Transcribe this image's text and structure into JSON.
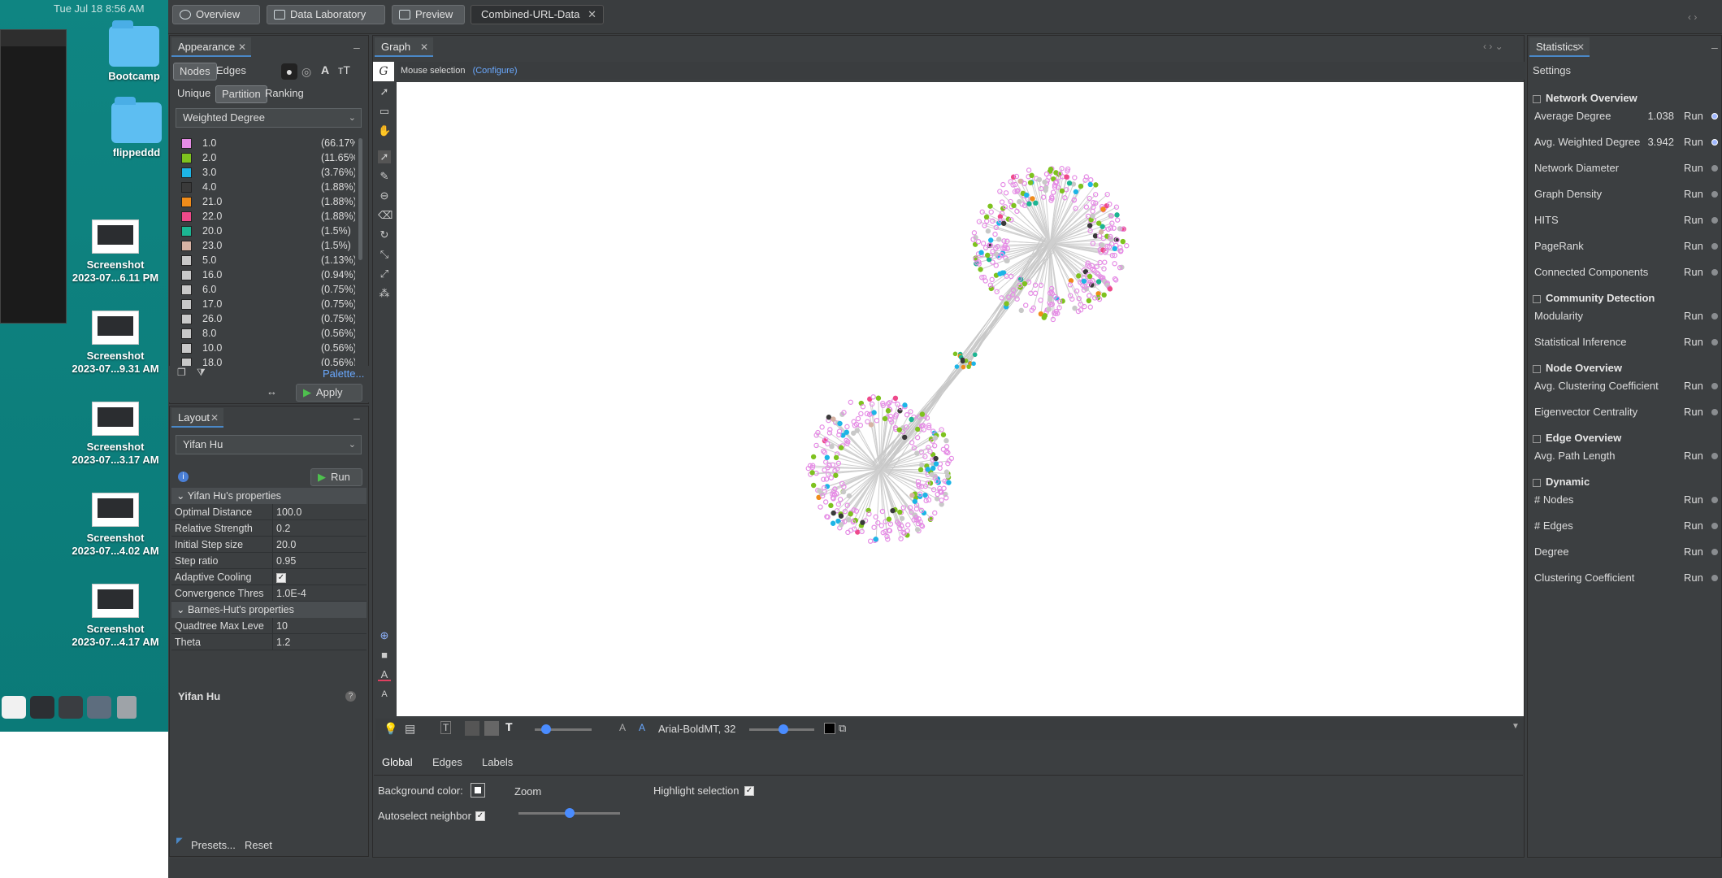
{
  "menubar": {
    "datetime": "Tue Jul 18  8:56 AM"
  },
  "desktop": {
    "folders": [
      {
        "label": "Bootcamp"
      },
      {
        "label": "flippeddd"
      }
    ],
    "screenshots": [
      {
        "line1": "Screenshot",
        "line2": "2023-07...6.11 PM"
      },
      {
        "line1": "Screenshot",
        "line2": "2023-07...9.31 AM"
      },
      {
        "line1": "Screenshot",
        "line2": "2023-07...3.17 AM"
      },
      {
        "line1": "Screenshot",
        "line2": "2023-07...4.02 AM"
      },
      {
        "line1": "Screenshot",
        "line2": "2023-07...4.17 AM"
      }
    ]
  },
  "top_tabs": [
    {
      "label": "Overview",
      "icon": "globe-icon"
    },
    {
      "label": "Data Laboratory",
      "icon": "table-icon"
    },
    {
      "label": "Preview",
      "icon": "monitor-icon"
    }
  ],
  "workspace_tab": {
    "label": "Combined-URL-Data"
  },
  "appearance": {
    "tab": "Appearance",
    "subtabs": [
      "Nodes",
      "Edges"
    ],
    "modes": [
      "Unique",
      "Partition",
      "Ranking"
    ],
    "attribute": "Weighted Degree",
    "partitions": [
      {
        "value": "1.0",
        "pct": "(66.17%)",
        "color": "#e58ce5"
      },
      {
        "value": "2.0",
        "pct": "(11.65%)",
        "color": "#7ec21f"
      },
      {
        "value": "3.0",
        "pct": "(3.76%)",
        "color": "#1db5e6"
      },
      {
        "value": "4.0",
        "pct": "(1.88%)",
        "color": "#3a3a3a"
      },
      {
        "value": "21.0",
        "pct": "(1.88%)",
        "color": "#f08c1a"
      },
      {
        "value": "22.0",
        "pct": "(1.88%)",
        "color": "#ee4a8a"
      },
      {
        "value": "20.0",
        "pct": "(1.5%)",
        "color": "#1cb592"
      },
      {
        "value": "23.0",
        "pct": "(1.5%)",
        "color": "#d6b3a4"
      },
      {
        "value": "5.0",
        "pct": "(1.13%)",
        "color": "#c8c8c8"
      },
      {
        "value": "16.0",
        "pct": "(0.94%)",
        "color": "#c8c8c8"
      },
      {
        "value": "6.0",
        "pct": "(0.75%)",
        "color": "#c8c8c8"
      },
      {
        "value": "17.0",
        "pct": "(0.75%)",
        "color": "#c8c8c8"
      },
      {
        "value": "26.0",
        "pct": "(0.75%)",
        "color": "#c8c8c8"
      },
      {
        "value": "8.0",
        "pct": "(0.56%)",
        "color": "#c8c8c8"
      },
      {
        "value": "10.0",
        "pct": "(0.56%)",
        "color": "#c8c8c8"
      },
      {
        "value": "18.0",
        "pct": "(0.56%)",
        "color": "#c8c8c8"
      }
    ],
    "palette_link": "Palette...",
    "arrows": "↔",
    "apply": "Apply"
  },
  "layout": {
    "tab": "Layout",
    "algorithm": "Yifan Hu",
    "run": "Run",
    "section1": "Yifan Hu's properties",
    "props1": [
      {
        "k": "Optimal Distance",
        "v": "100.0"
      },
      {
        "k": "Relative Strength",
        "v": "0.2"
      },
      {
        "k": "Initial Step size",
        "v": "20.0"
      },
      {
        "k": "Step ratio",
        "v": "0.95"
      },
      {
        "k": "Adaptive Cooling",
        "v": "✓"
      },
      {
        "k": "Convergence Thres",
        "v": "1.0E-4"
      }
    ],
    "section2": "Barnes-Hut's properties",
    "props2": [
      {
        "k": "Quadtree Max Leve",
        "v": "10"
      },
      {
        "k": "Theta",
        "v": "1.2"
      }
    ],
    "footer_title": "Yifan Hu",
    "presets": "Presets...",
    "reset": "Reset"
  },
  "graph": {
    "tab": "Graph",
    "mouse_selection": "Mouse selection",
    "configure": "(Configure)",
    "font_label": "Arial-BoldMT, 32",
    "bottom_tabs": [
      "Global",
      "Edges",
      "Labels"
    ],
    "background_color_label": "Background color:",
    "zoom_label": "Zoom",
    "highlight_label": "Highlight selection",
    "autoselect_label": "Autoselect neighbor",
    "zoom_level": 0.5
  },
  "statistics": {
    "tab": "Statistics",
    "settings": "Settings",
    "run": "Run",
    "sections": [
      {
        "title": "Network Overview",
        "items": [
          {
            "name": "Average Degree",
            "value": "1.038",
            "info": true
          },
          {
            "name": "Avg. Weighted Degree",
            "value": "3.942",
            "info": true
          },
          {
            "name": "Network Diameter",
            "value": ""
          },
          {
            "name": "Graph Density",
            "value": ""
          },
          {
            "name": "HITS",
            "value": ""
          },
          {
            "name": "PageRank",
            "value": ""
          },
          {
            "name": "Connected Components",
            "value": ""
          }
        ]
      },
      {
        "title": "Community Detection",
        "items": [
          {
            "name": "Modularity",
            "value": ""
          },
          {
            "name": "Statistical Inference",
            "value": ""
          }
        ]
      },
      {
        "title": "Node Overview",
        "items": [
          {
            "name": "Avg. Clustering Coefficient",
            "value": ""
          },
          {
            "name": "Eigenvector Centrality",
            "value": ""
          }
        ]
      },
      {
        "title": "Edge Overview",
        "items": [
          {
            "name": "Avg. Path Length",
            "value": ""
          }
        ]
      },
      {
        "title": "Dynamic",
        "items": [
          {
            "name": "# Nodes",
            "value": ""
          },
          {
            "name": "# Edges",
            "value": ""
          },
          {
            "name": "Degree",
            "value": ""
          },
          {
            "name": "Clustering Coefficient",
            "value": ""
          }
        ]
      }
    ]
  }
}
